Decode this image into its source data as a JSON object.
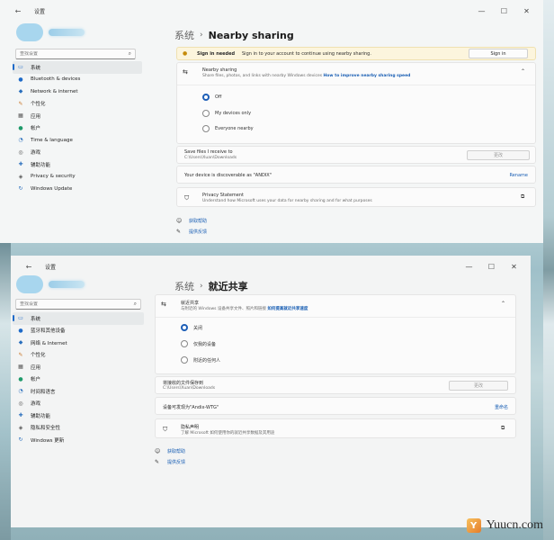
{
  "win1": {
    "title": "设置",
    "search_placeholder": "查找设置",
    "nav": [
      {
        "label": "系统",
        "icon": "system-icon",
        "active": true
      },
      {
        "label": "Bluetooth & devices",
        "icon": "bluetooth-icon"
      },
      {
        "label": "Network & internet",
        "icon": "network-icon"
      },
      {
        "label": "个性化",
        "icon": "personalization-icon"
      },
      {
        "label": "应用",
        "icon": "apps-icon"
      },
      {
        "label": "帐户",
        "icon": "accounts-icon"
      },
      {
        "label": "Time & language",
        "icon": "time-icon"
      },
      {
        "label": "游戏",
        "icon": "gaming-icon"
      },
      {
        "label": "辅助功能",
        "icon": "accessibility-icon"
      },
      {
        "label": "Privacy & security",
        "icon": "privacy-icon"
      },
      {
        "label": "Windows Update",
        "icon": "update-icon"
      }
    ],
    "breadcrumb": {
      "parent": "系统",
      "separator": "›",
      "current": "Nearby sharing"
    },
    "notice": {
      "bold": "Sign in needed",
      "text": "Sign in to your account to continue using nearby sharing.",
      "button": "Sign in"
    },
    "nearby": {
      "title": "Nearby sharing",
      "desc": "Share files, photos, and links with nearby Windows devices",
      "link": "How to improve nearby sharing speed",
      "options": [
        "Off",
        "My devices only",
        "Everyone nearby"
      ],
      "selected_index": 0
    },
    "save": {
      "title": "Save files I receive to",
      "path": "C:\\Users\\Xuan\\Downloads",
      "button": "更改"
    },
    "discoverable": {
      "text": "Your device is discoverable as \"ANDIX\"",
      "link": "Rename"
    },
    "privacy": {
      "title": "Privacy Statement",
      "desc": "Understand how Microsoft uses your data for nearby sharing and for what purposes"
    },
    "help": [
      "获取帮助",
      "提供反馈"
    ]
  },
  "win2": {
    "title": "设置",
    "search_placeholder": "查找设置",
    "nav": [
      {
        "label": "系统",
        "icon": "system-icon",
        "active": true
      },
      {
        "label": "蓝牙和其他设备",
        "icon": "bluetooth-icon"
      },
      {
        "label": "网络 & Internet",
        "icon": "network-icon"
      },
      {
        "label": "个性化",
        "icon": "personalization-icon"
      },
      {
        "label": "应用",
        "icon": "apps-icon"
      },
      {
        "label": "帐户",
        "icon": "accounts-icon"
      },
      {
        "label": "时间和语言",
        "icon": "time-icon"
      },
      {
        "label": "游戏",
        "icon": "gaming-icon"
      },
      {
        "label": "辅助功能",
        "icon": "accessibility-icon"
      },
      {
        "label": "隐私和安全性",
        "icon": "privacy-icon"
      },
      {
        "label": "Windows 更新",
        "icon": "update-icon"
      }
    ],
    "breadcrumb": {
      "parent": "系统",
      "separator": "›",
      "current": "就近共享"
    },
    "nearby": {
      "title": "就近共享",
      "desc": "与附近的 Windows 设备共享文件、照片和链接",
      "link": "如何提高就近共享速度",
      "options": [
        "关闭",
        "仅我的设备",
        "附近的任何人"
      ],
      "selected_index": 0
    },
    "save": {
      "title": "将接收的文件保存到",
      "path": "C:\\Users\\Xuan\\Downloads",
      "button": "更改"
    },
    "discoverable": {
      "text": "设备可发现为\"Andix-WTG\"",
      "link": "重命名"
    },
    "privacy": {
      "title": "隐私声明",
      "desc": "了解 Microsoft 如何使用你的就近共享数据及其用途"
    },
    "help": [
      "获取帮助",
      "提供反馈"
    ]
  },
  "watermark": {
    "logo": "Y",
    "text": "Yuucn.com"
  },
  "colors": {
    "accent": "#1e5fb7",
    "link": "#1a5fb4",
    "notice_bg": "#fcf5dd"
  }
}
